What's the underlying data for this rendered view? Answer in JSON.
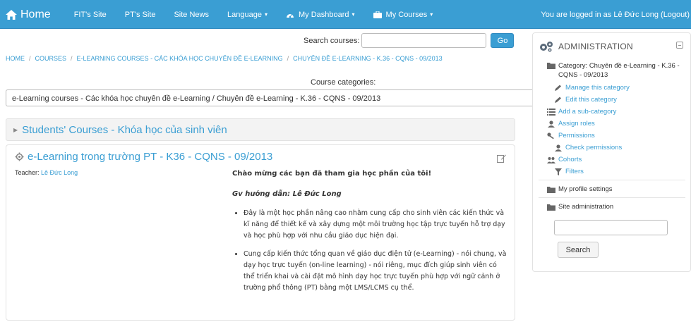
{
  "navbar": {
    "home_label": "Home",
    "items": [
      {
        "label": "FIT's Site"
      },
      {
        "label": "PT's Site"
      },
      {
        "label": "Site News"
      },
      {
        "label": "Language",
        "caret": "▾"
      },
      {
        "label": "My Dashboard",
        "caret": "▾",
        "icon": "dashboard-icon"
      },
      {
        "label": "My Courses",
        "caret": "▾",
        "icon": "briefcase-icon"
      }
    ],
    "login_text": "You are logged in as Lê Đức Long (Logout)"
  },
  "search": {
    "label": "Search courses:",
    "value": "",
    "button_label": "Go"
  },
  "breadcrumb": [
    "HOME",
    "COURSES",
    "E-LEARNING COURSES - CÁC KHÓA HỌC CHUYÊN ĐỀ E-LEARNING",
    "CHUYÊN ĐỀ E-LEARNING - K.36 - CQNS - 09/2013"
  ],
  "categories": {
    "label": "Course categories:",
    "selected": "e-Learning courses - Các khóa học chuyên đề e-Learning / Chuyên đề e-Learning - K.36 - CQNS - 09/2013"
  },
  "students_section": {
    "title": "Students' Courses - Khóa học của sinh viên"
  },
  "course": {
    "title": "e-Learning trong trường PT - K36 - CQNS - 09/2013",
    "teacher_label": "Teacher:",
    "teacher_name": "Lê Đức Long",
    "welcome": "Chào mừng các bạn đã tham gia học phần của tôi!",
    "guide": "Gv hướng dẫn: Lê Đức Long",
    "bullets": [
      "Đây là một học phần nâng cao nhằm cung cấp cho sinh viên các kiến thức và kĩ năng để thiết kế và xây dựng một môi trường học tập trực tuyến hỗ trợ dạy và học phù hợp với nhu cầu giáo dục hiện đại.",
      "Cung cấp kiến thức tổng quan về giáo dục điện tử (e-Learning) - nói chung, và dạy học trực tuyến (on-line learning) - nói riêng, mục đích giúp sinh viên có thể triển khai và cài đặt mô hình dạy học trực tuyến phù hợp với ngữ cảnh ở trường phổ thông (PT) bằng một LMS/LCMS cụ thể."
    ]
  },
  "admin": {
    "title": "ADMINISTRATION",
    "category": "Category: Chuyên đề e-Learning - K.36 - CQNS - 09/2013",
    "links": {
      "manage": "Manage this category",
      "edit": "Edit this category",
      "add_sub": "Add a sub-category",
      "assign_roles": "Assign roles",
      "permissions": "Permissions",
      "check_permissions": "Check permissions",
      "cohorts": "Cohorts",
      "filters": "Filters"
    },
    "profile_settings": "My profile settings",
    "site_admin": "Site administration",
    "search_value": "",
    "search_button": "Search"
  },
  "colors": {
    "navbar": "#3a9ed3",
    "link": "#3a9ed3"
  }
}
